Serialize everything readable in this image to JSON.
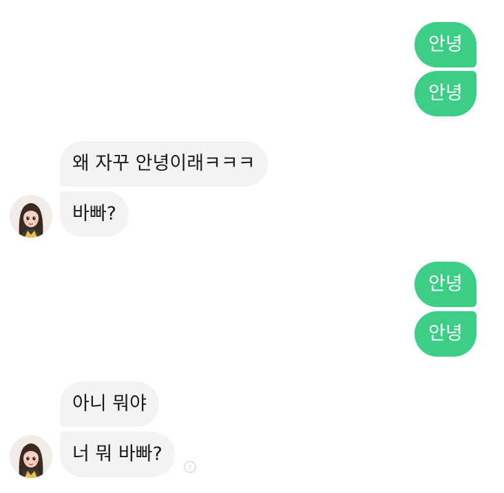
{
  "chat": {
    "messages": [
      {
        "direction": "sent",
        "text": "안녕"
      },
      {
        "direction": "sent",
        "text": "안녕"
      },
      {
        "direction": "received",
        "text": "왜 자꾸 안녕이래ㅋㅋㅋ"
      },
      {
        "direction": "received",
        "text": "바빠?"
      },
      {
        "direction": "sent",
        "text": "안녕"
      },
      {
        "direction": "sent",
        "text": "안녕"
      },
      {
        "direction": "received",
        "text": "아니 뭐야"
      },
      {
        "direction": "received",
        "text": "너 뭐 바빠?"
      }
    ]
  },
  "icons": {
    "avatar": "girl-avatar-icon",
    "status": "info-circle-icon"
  },
  "colors": {
    "sent_bubble": "#3ccd87",
    "sent_text": "#ffffff",
    "received_bubble": "#f3f3f3",
    "received_text": "#1a1a1a",
    "background": "#ffffff"
  }
}
